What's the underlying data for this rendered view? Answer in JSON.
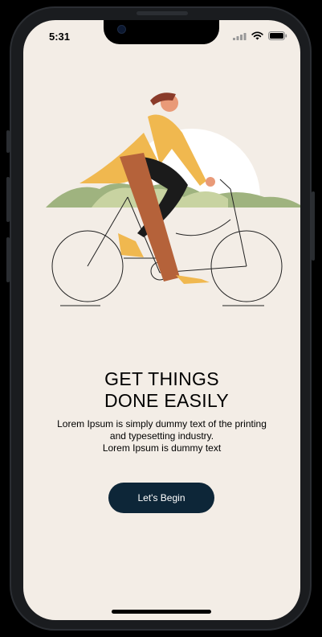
{
  "status_bar": {
    "time": "5:31"
  },
  "onboarding": {
    "title_line1": "GET THINGS",
    "title_line2": "DONE EASILY",
    "desc_line1": "Lorem Ipsum is simply dummy text of the printing",
    "desc_line2": "and typesetting industry.",
    "desc_line3": "Lorem Ipsum is dummy text",
    "cta_label": "Let's Begin"
  },
  "colors": {
    "background": "#f3ede6",
    "button": "#0d2638",
    "coat": "#f0b84f",
    "pants": "#b5623a",
    "hills": "#9fb37f"
  },
  "icons": [
    "signal-icon",
    "wifi-icon",
    "battery-icon"
  ]
}
